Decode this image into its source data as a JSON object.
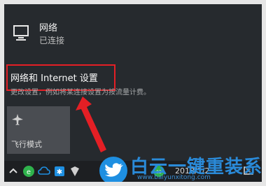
{
  "network": {
    "title": "网络",
    "status": "已连接",
    "icon": "network-monitor-icon"
  },
  "settings": {
    "link_label": "网络和 Internet 设置",
    "description": "更改设置，例如将某连接设置为按流量计费。"
  },
  "quick_action": {
    "label": "飞行模式",
    "icon": "airplane-icon"
  },
  "taskbar": {
    "clock_partial": "2018/1/2"
  },
  "watermark": {
    "text": "白云一键重装系统",
    "url": "www.baiyunxitong.com"
  },
  "colors": {
    "highlight": "#e41f25",
    "panel": "#262a2e",
    "tile": "#4a4d52",
    "watermark": "#2a8ad8"
  }
}
